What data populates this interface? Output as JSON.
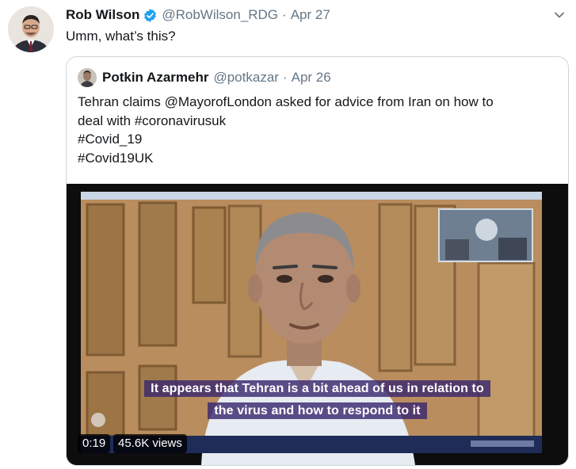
{
  "tweet": {
    "author_name": "Rob Wilson",
    "handle": "@RobWilson_RDG",
    "separator": "·",
    "date": "Apr 27",
    "text": "Umm, what’s this?",
    "icons": {
      "verified": "verified-badge-icon",
      "menu": "chevron-down-icon",
      "avatar": "profile-avatar"
    }
  },
  "quoted_tweet": {
    "author_name": "Potkin Azarmehr",
    "handle": "@potkazar",
    "separator": "·",
    "date": "Apr 26",
    "text_lines": [
      "Tehran claims @MayorofLondon asked for advice from Iran on how to",
      "deal with #coronavirusuk",
      "#Covid_19",
      "#Covid19UK"
    ]
  },
  "video": {
    "subtitle_lines": [
      "It appears that Tehran is a bit ahead of us in relation to",
      "the virus and how to respond to it"
    ],
    "duration": "0:19",
    "views": "45.6K views"
  },
  "colors": {
    "primary_text": "#14171a",
    "secondary_text": "#657786",
    "verified_blue": "#1da1f2",
    "border": "#ccd6dd",
    "subtitle_bg": "#3a286e"
  }
}
